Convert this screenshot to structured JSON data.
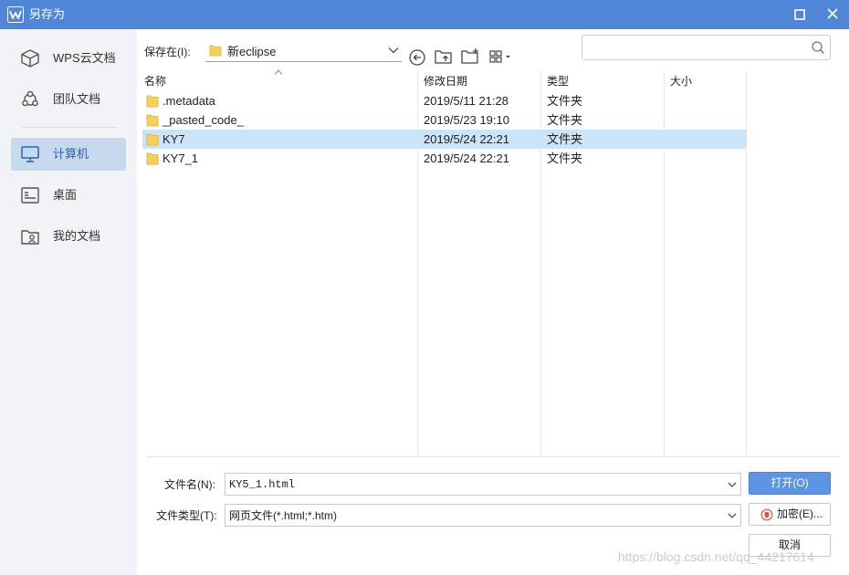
{
  "window": {
    "title": "另存为"
  },
  "sidebar": {
    "items": [
      {
        "label": "WPS云文档",
        "icon": "cube-icon"
      },
      {
        "label": "团队文档",
        "icon": "team-icon"
      },
      {
        "label": "计算机",
        "icon": "computer-icon",
        "active": true
      },
      {
        "label": "桌面",
        "icon": "desktop-icon"
      },
      {
        "label": "我的文档",
        "icon": "user-folder-icon"
      }
    ]
  },
  "toolbar": {
    "save_in_label": "保存在(I):",
    "current_folder": "新eclipse",
    "search_placeholder": ""
  },
  "file_list": {
    "columns": [
      "名称",
      "修改日期",
      "类型",
      "大小"
    ],
    "rows": [
      {
        "name": ".metadata",
        "modified": "2019/5/11 21:28",
        "type": "文件夹",
        "size": ""
      },
      {
        "name": "_pasted_code_",
        "modified": "2019/5/23 19:10",
        "type": "文件夹",
        "size": ""
      },
      {
        "name": "KY7",
        "modified": "2019/5/24 22:21",
        "type": "文件夹",
        "size": "",
        "selected": true
      },
      {
        "name": "KY7_1",
        "modified": "2019/5/24 22:21",
        "type": "文件夹",
        "size": ""
      }
    ]
  },
  "form": {
    "filename_label": "文件名(N):",
    "filename_value": "KY5_1.html",
    "filetype_label": "文件类型(T):",
    "filetype_value": "网页文件(*.html;*.htm)",
    "open_button": "打开(O)",
    "encrypt_button": "加密(E)...",
    "cancel_button": "取消"
  },
  "watermark": "https://blog.csdn.net/qq_44217614",
  "colors": {
    "titlebar": "#4f86d8",
    "selection": "#cce4f7",
    "sidebar_active": "#c6d9ee",
    "primary_button": "#5c95e3",
    "folder": "#f7cf5e"
  }
}
